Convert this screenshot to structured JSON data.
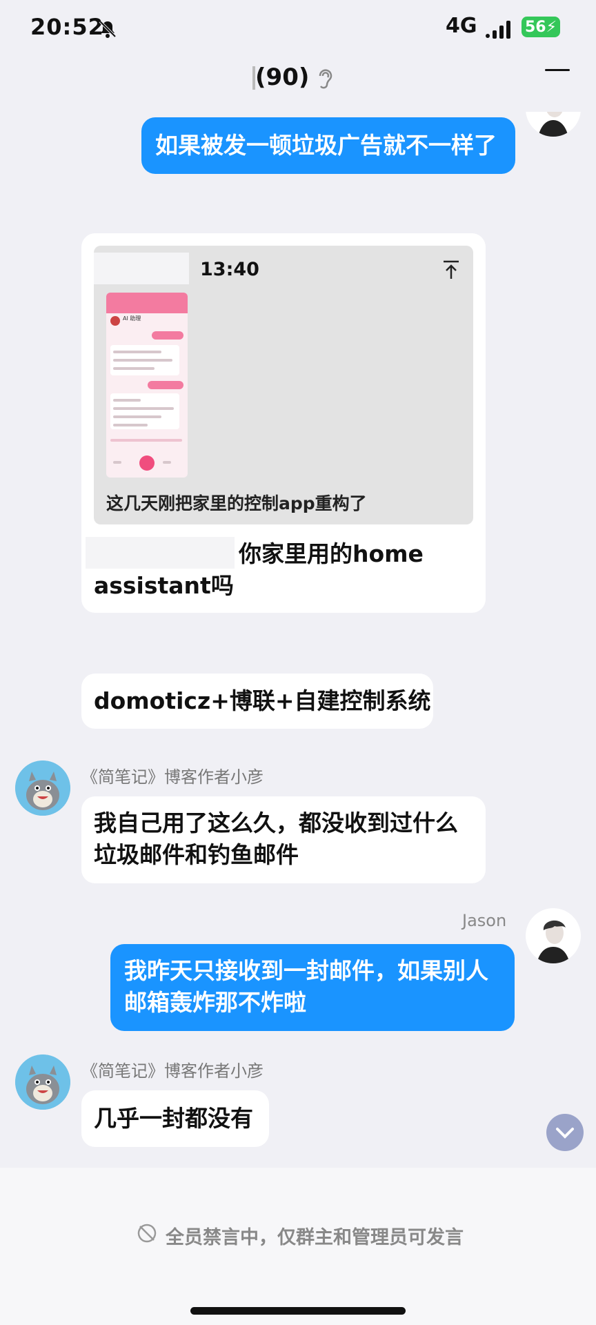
{
  "status_bar": {
    "time": "20:52",
    "network": "4G",
    "battery": "56"
  },
  "nav": {
    "title": "(90)"
  },
  "messages": [
    {
      "side": "me",
      "text": "如果被发一顿垃圾广告就不一样了"
    },
    {
      "side": "other",
      "quote_time": "13:40",
      "quote_caption": "这几天刚把家里的控制app重构了",
      "text_line1": "你家里用的home",
      "text_line2": "assistant吗"
    },
    {
      "side": "other",
      "text": "domoticz+博联+自建控制系统"
    },
    {
      "side": "other",
      "sender": "《简笔记》博客作者小彦",
      "text_line1": "我自己用了这么久，都没收到过什么",
      "text_line2": "垃圾邮件和钓鱼邮件"
    },
    {
      "side": "me",
      "sender": "Jason",
      "text_line1": "我昨天只接收到一封邮件，如果别人",
      "text_line2": "邮箱轰炸那不炸啦"
    },
    {
      "side": "other",
      "sender": "《简笔记》博客作者小彦",
      "text": "几乎一封都没有"
    }
  ],
  "mini_screenshot": {
    "title": "AI 助理"
  },
  "bottom": {
    "mute_notice": "全员禁言中，仅群主和管理员可发言"
  }
}
